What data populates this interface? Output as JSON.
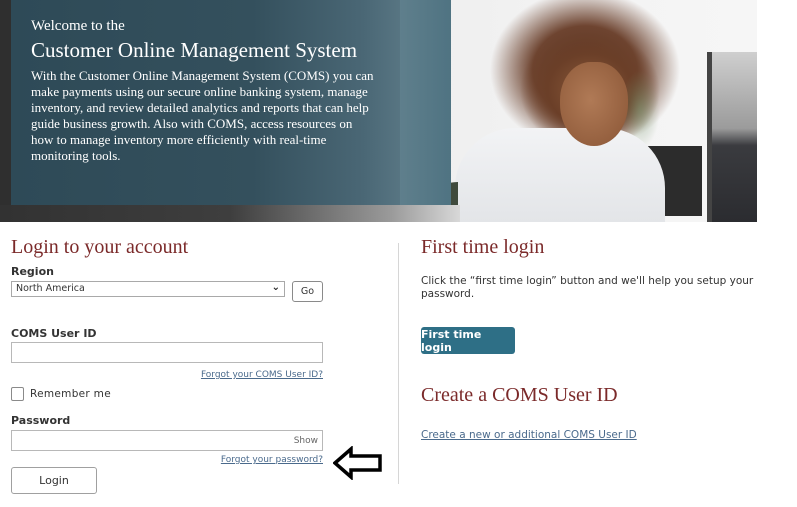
{
  "hero": {
    "kicker": "Welcome to the",
    "title": "Customer Online Management System",
    "body": "With the Customer Online Management System (COMS) you can make payments using our secure online banking system, manage inventory, and review detailed analytics and reports that can help guide business growth. Also with COMS, access resources on how to manage inventory more efficiently with real-time monitoring tools.",
    "image_description": "woman-at-computer-photo"
  },
  "login": {
    "heading": "Login to your account",
    "region": {
      "label": "Region",
      "selected": "North America",
      "go_label": "Go"
    },
    "user_id": {
      "label": "COMS User ID",
      "value": "",
      "forgot_link": "Forgot your COMS User ID?"
    },
    "remember_me": {
      "label": "Remember me",
      "checked": false
    },
    "password": {
      "label": "Password",
      "value": "",
      "show_label": "Show",
      "forgot_link": "Forgot your password?"
    },
    "submit_label": "Login"
  },
  "first_time": {
    "heading": "First time login",
    "description": "Click the “first time login” button and we'll help you setup your password.",
    "button_label": "First time login"
  },
  "create_id": {
    "heading": "Create a COMS User ID",
    "link": "Create a new or additional COMS User ID"
  },
  "annotation": {
    "icon": "left-arrow-icon",
    "target": "Forgot your password?"
  },
  "colors": {
    "heading": "#7b2a2a",
    "primary_button": "#2e6f86",
    "link": "#4a6a8c",
    "hero_panel": "#2e4a57"
  }
}
